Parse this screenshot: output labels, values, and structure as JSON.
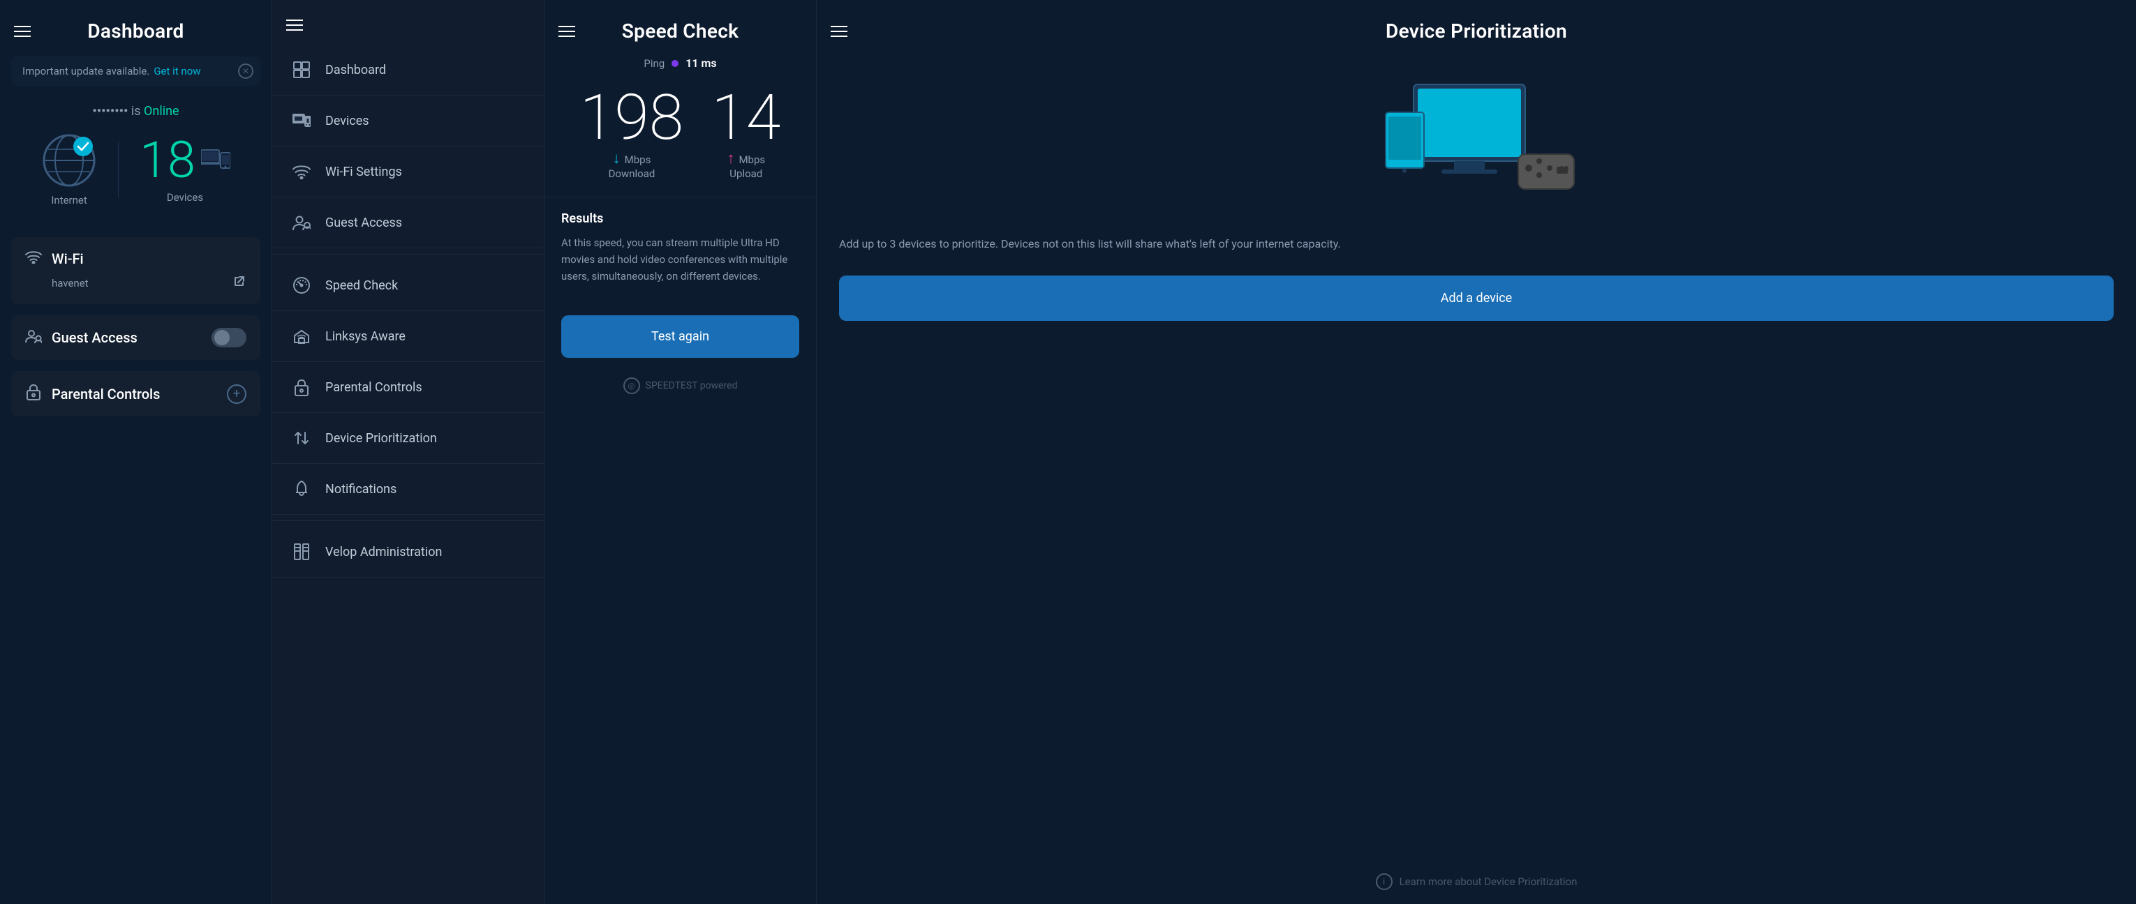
{
  "panel1": {
    "title": "Dashboard",
    "update_banner": {
      "text": "Important update available.",
      "link": "Get it now"
    },
    "status": {
      "router_name": "••••••••",
      "is_label": "is",
      "online_label": "Online"
    },
    "internet_label": "Internet",
    "devices_count": "18",
    "devices_label": "Devices",
    "wifi_section": {
      "title": "Wi-Fi",
      "network_name": "havenet",
      "external_link": "↗"
    },
    "guest_access": {
      "title": "Guest Access"
    },
    "parental_controls": {
      "title": "Parental Controls"
    }
  },
  "panel2": {
    "nav_items": [
      {
        "icon": "grid",
        "label": "Dashboard"
      },
      {
        "icon": "devices",
        "label": "Devices"
      },
      {
        "icon": "wifi",
        "label": "Wi-Fi Settings"
      },
      {
        "icon": "users",
        "label": "Guest Access"
      },
      {
        "icon": "speedcheck",
        "label": "Speed Check"
      },
      {
        "icon": "home",
        "label": "Linksys Aware"
      },
      {
        "icon": "lock",
        "label": "Parental Controls"
      },
      {
        "icon": "arrows",
        "label": "Device Prioritization"
      },
      {
        "icon": "bell",
        "label": "Notifications"
      },
      {
        "icon": "bars",
        "label": "Velop Administration"
      }
    ]
  },
  "panel3": {
    "title": "Speed Check",
    "ping_label": "Ping",
    "ping_value": "11 ms",
    "download": {
      "value": "198",
      "unit": "Mbps",
      "label": "Download"
    },
    "upload": {
      "value": "14",
      "unit": "Mbps",
      "label": "Upload"
    },
    "results_title": "Results",
    "results_text": "At this speed, you can stream multiple Ultra HD movies and hold video conferences with multiple users, simultaneously, on different devices.",
    "test_again_label": "Test again",
    "speedtest_brand": "SPEEDTEST powered"
  },
  "panel4": {
    "title": "Device Prioritization",
    "description": "Add up to 3 devices to prioritize. Devices not on this list will share what's left of your internet capacity.",
    "add_device_label": "Add a device",
    "learn_more_label": "Learn more about Device Prioritization"
  }
}
